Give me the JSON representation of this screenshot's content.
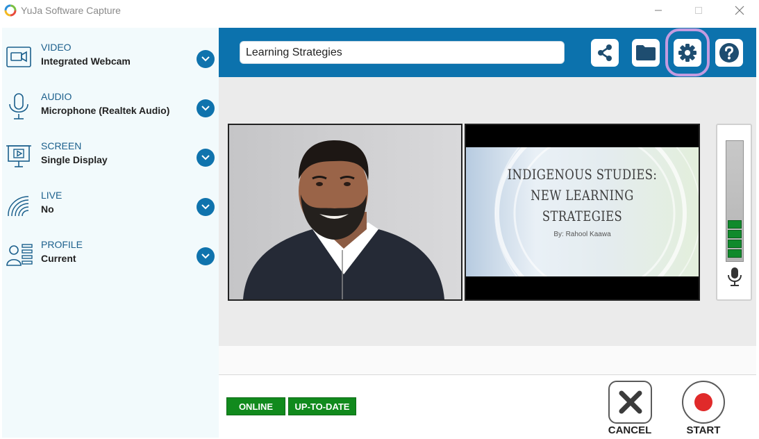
{
  "window": {
    "title": "YuJa Software Capture"
  },
  "sidebar": {
    "items": [
      {
        "title": "VIDEO",
        "value": "Integrated Webcam",
        "icon": "webcam-icon"
      },
      {
        "title": "AUDIO",
        "value": "Microphone (Realtek Audio)",
        "icon": "microphone-icon"
      },
      {
        "title": "SCREEN",
        "value": "Single Display",
        "icon": "screen-display-icon"
      },
      {
        "title": "LIVE",
        "value": "No",
        "icon": "live-broadcast-icon"
      },
      {
        "title": "PROFILE",
        "value": "Current",
        "icon": "profile-icon"
      }
    ]
  },
  "toolbar": {
    "title_value": "Learning Strategies",
    "buttons": [
      "share-icon",
      "folder-icon",
      "gear-icon",
      "help-icon"
    ]
  },
  "preview": {
    "slide_title_line1": "INDIGENOUS STUDIES:",
    "slide_title_line2": "NEW LEARNING",
    "slide_title_line3": "STRATEGIES",
    "slide_author": "By: Rahool Kaawa",
    "audio_level_segments": 5
  },
  "status": {
    "online": "ONLINE",
    "update": "UP-TO-DATE"
  },
  "actions": {
    "cancel": "CANCEL",
    "start": "START"
  },
  "colors": {
    "accent": "#0c72ad",
    "sidebar_bg": "#f2fafc",
    "status_green": "#118a1d",
    "record_red": "#e02a2a",
    "highlight_ring": "#c39be0"
  }
}
